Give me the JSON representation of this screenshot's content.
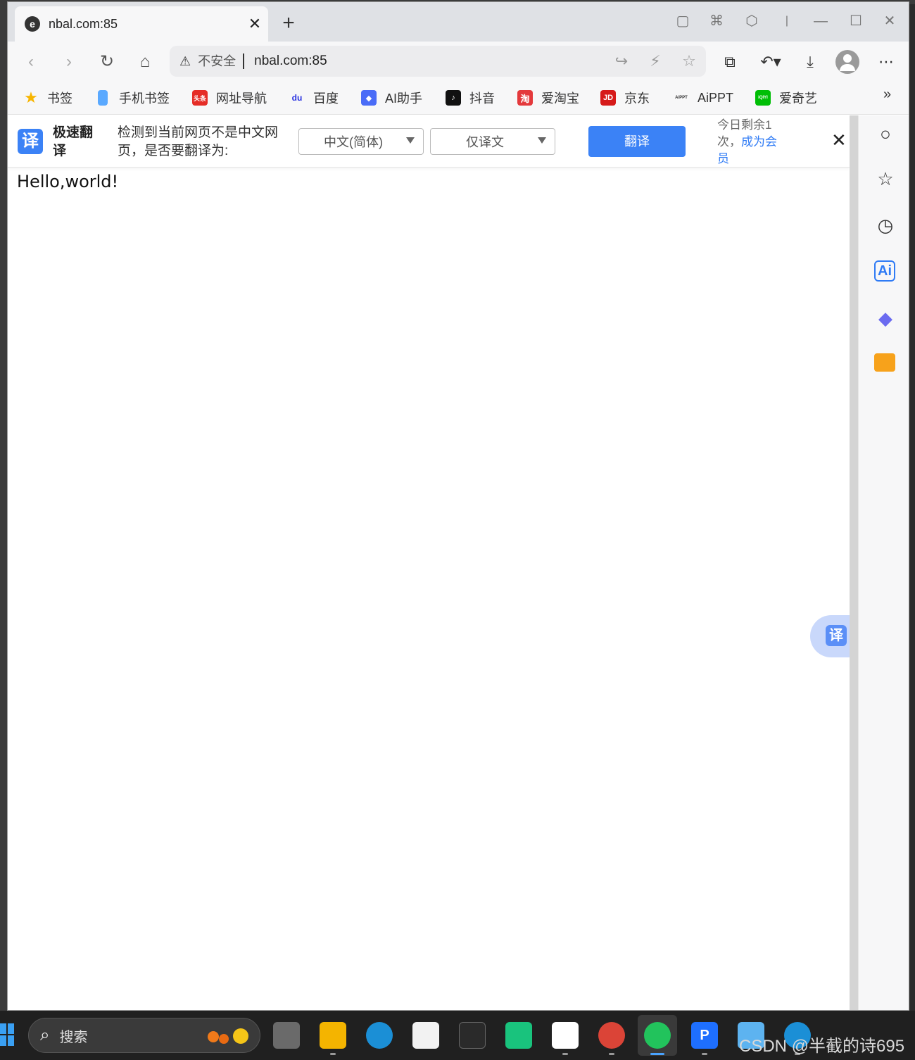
{
  "tab": {
    "title": "nbal.com:85",
    "favicon": "edge-logo-icon"
  },
  "omnibox": {
    "security_label": "不安全",
    "url": "nbal.com:85"
  },
  "bookmarks": [
    {
      "label": "书签",
      "icon": "star-icon",
      "color": "#f7b500"
    },
    {
      "label": "手机书签",
      "icon": "phone-icon",
      "color": "#5aa9ff"
    },
    {
      "label": "网址导航",
      "icon": "hao-icon",
      "color": "#e52d27",
      "glyph": "头条"
    },
    {
      "label": "百度",
      "icon": "baidu-paw-icon",
      "color": "#2932e1",
      "glyph": "du"
    },
    {
      "label": "AI助手",
      "icon": "ai-assistant-icon",
      "color": "#4a6cf7",
      "glyph": "◆"
    },
    {
      "label": "抖音",
      "icon": "douyin-icon",
      "color": "#111111",
      "glyph": "♪"
    },
    {
      "label": "爱淘宝",
      "icon": "taobao-icon",
      "color": "#e4393c",
      "glyph": "淘"
    },
    {
      "label": "京东",
      "icon": "jd-icon",
      "color": "#d61a1a",
      "glyph": "JD"
    },
    {
      "label": "AiPPT",
      "icon": "aippt-icon",
      "color": "#333333",
      "glyph": "AiPPT"
    },
    {
      "label": "爱奇艺",
      "icon": "iqiyi-icon",
      "color": "#00be06",
      "glyph": "iQIYI"
    }
  ],
  "bookmarks_more": "»",
  "translate_bar": {
    "logo_glyph": "译",
    "name": "极速翻译",
    "message": "检测到当前网页不是中文网页，是否要翻译为:",
    "target_language": "中文(简体)",
    "mode": "仅译文",
    "translate_button": "翻译",
    "quota_prefix": "今日剩余1次，",
    "quota_link": "成为会员",
    "close": "✕"
  },
  "page": {
    "content": "Hello,world!"
  },
  "float_translate": {
    "glyph": "译"
  },
  "taskbar": {
    "search_placeholder": "搜索",
    "watermark": "CSDN @半截的诗695"
  },
  "colors": {
    "accent": "#3b82f6",
    "link": "#2f7bf5",
    "taskbar": "#202020"
  }
}
